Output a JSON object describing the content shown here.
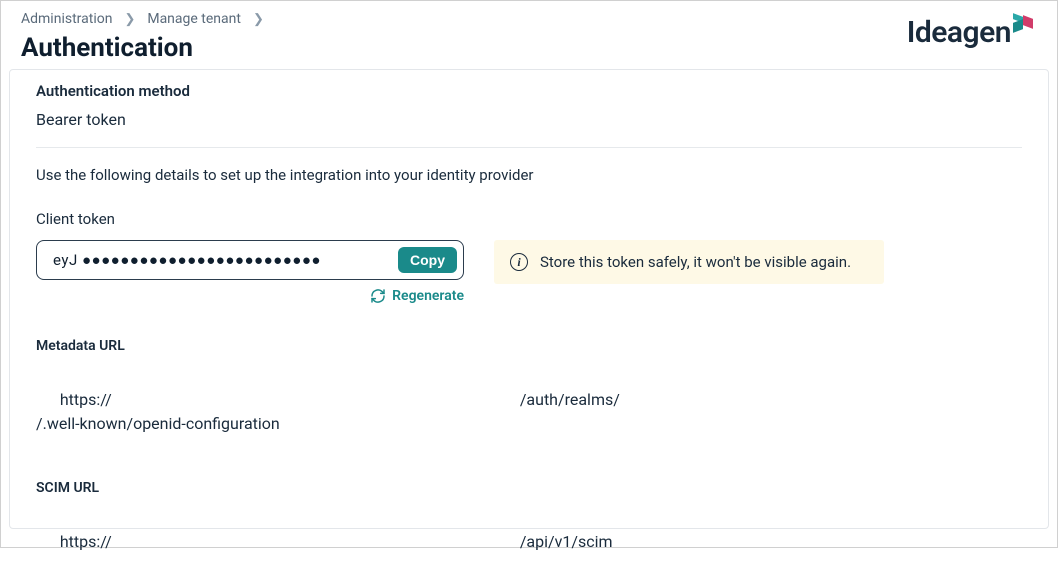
{
  "breadcrumb": {
    "items": [
      "Administration",
      "Manage tenant"
    ]
  },
  "page_title": "Authentication",
  "brand": "Ideagen",
  "auth_method": {
    "label": "Authentication method",
    "value": "Bearer token"
  },
  "integration_helper": "Use the following details to set up the integration into your identity provider",
  "client_token": {
    "label": "Client token",
    "masked_value": "eyJ ●●●●●●●●●●●●●●●●●●●●●●●●●",
    "copy_label": "Copy",
    "regenerate_label": "Regenerate"
  },
  "notice": {
    "text": "Store this token safely, it won't be visible again."
  },
  "metadata_url": {
    "label": "Metadata URL",
    "prefix": "https://",
    "mid": "/auth/realms/",
    "suffix": "/.well-known/openid-configuration"
  },
  "scim_url": {
    "label": "SCIM URL",
    "prefix": "https://",
    "suffix": "/api/v1/scim"
  }
}
